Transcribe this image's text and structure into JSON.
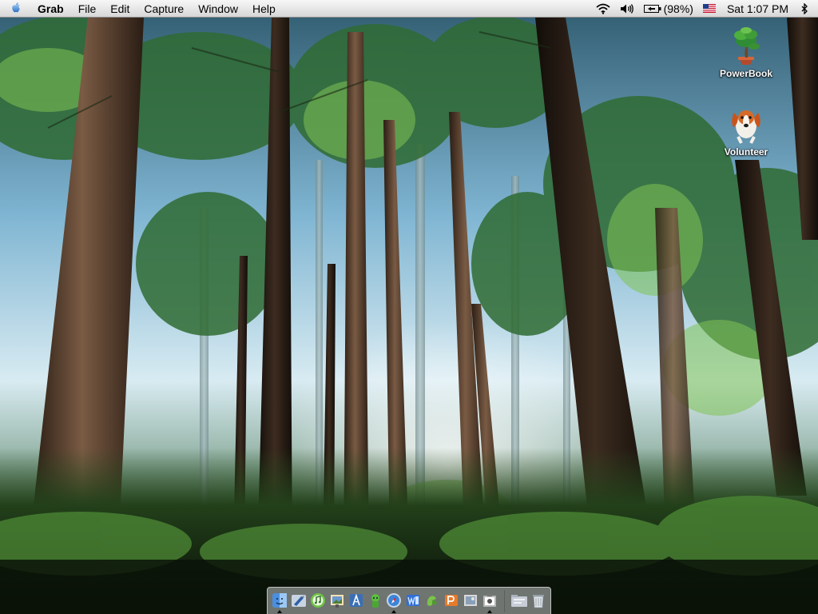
{
  "menubar": {
    "apple_icon": "apple-icon",
    "app_name": "Grab",
    "menus": [
      "File",
      "Edit",
      "Capture",
      "Window",
      "Help"
    ],
    "status": {
      "wifi_icon": "wifi-icon",
      "volume_icon": "volume-icon",
      "battery_icon": "battery-icon",
      "battery_percent": "(98%)",
      "input_flag_icon": "us-flag-icon",
      "clock": "Sat 1:07 PM",
      "bluetooth_icon": "bluetooth-icon"
    }
  },
  "desktop": {
    "icons": [
      {
        "label": "PowerBook",
        "icon": "bonsai-tree-icon"
      },
      {
        "label": "Volunteer",
        "icon": "dog-icon"
      }
    ]
  },
  "dock": {
    "items": [
      {
        "icon": "finder-icon",
        "running": true
      },
      {
        "icon": "mail-icon",
        "running": false
      },
      {
        "icon": "itunes-icon",
        "running": false
      },
      {
        "icon": "iphoto-icon",
        "running": false
      },
      {
        "icon": "xcode-icon",
        "running": false
      },
      {
        "icon": "green-alien-icon",
        "running": false
      },
      {
        "icon": "safari-icon",
        "running": true
      },
      {
        "icon": "word-icon",
        "running": false
      },
      {
        "icon": "stickies-icon",
        "running": false
      },
      {
        "icon": "powerpoint-icon",
        "running": false
      },
      {
        "icon": "preview-icon",
        "running": false
      },
      {
        "icon": "grab-icon",
        "running": true
      }
    ],
    "right_items": [
      {
        "icon": "folder-icon"
      },
      {
        "icon": "trash-icon"
      }
    ]
  },
  "colors": {
    "menubar_bg": "#e6e6e6",
    "sky": "#b8d8ee",
    "foliage": "#3f7f42",
    "trunk": "#4a3426",
    "forest_floor": "#16210f"
  }
}
